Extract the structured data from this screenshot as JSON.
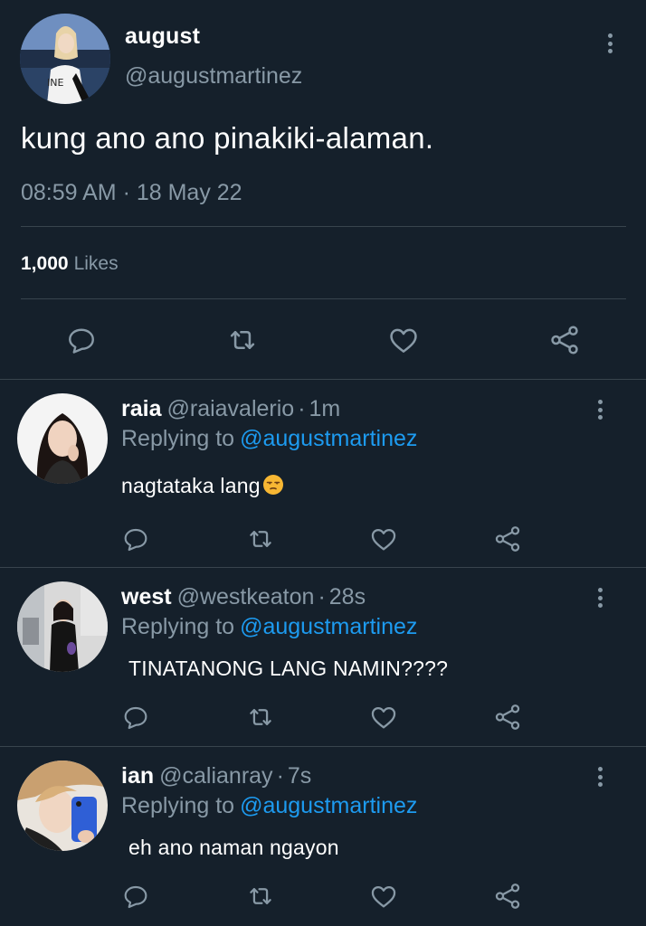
{
  "main_tweet": {
    "name": "august",
    "handle": "@augustmartinez",
    "text": "kung ano ano pinakiki-alaman.",
    "timestamp": "08:59 AM · 18 May 22",
    "likes_count": "1,000",
    "likes_label": "Likes",
    "actions": [
      "reply-icon",
      "retweet-icon",
      "like-icon",
      "share-icon"
    ]
  },
  "replies": [
    {
      "name": "raia",
      "handle": "@raiavalerio",
      "separator": "·",
      "time": "1m",
      "replying_label": "Replying to",
      "replying_to": "@augustmartinez",
      "text": "nagtataka lang",
      "emoji": "unamused-face-emoji"
    },
    {
      "name": "west",
      "handle": "@westkeaton",
      "separator": "·",
      "time": "28s",
      "replying_label": "Replying to",
      "replying_to": "@augustmartinez",
      "text": "TINATANONG LANG NAMIN????"
    },
    {
      "name": "ian",
      "handle": "@calianray",
      "separator": "·",
      "time": "7s",
      "replying_label": "Replying to",
      "replying_to": "@augustmartinez",
      "text": "eh ano naman ngayon"
    }
  ],
  "colors": {
    "background": "#15202b",
    "divider": "#38444d",
    "secondary_text": "#8899a6",
    "link": "#1d9bf0",
    "primary_text": "#ffffff"
  }
}
